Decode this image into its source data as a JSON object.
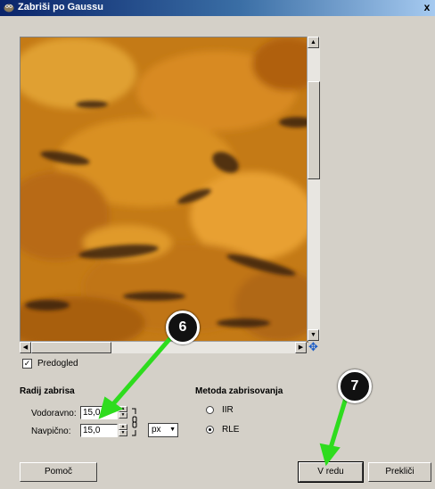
{
  "window": {
    "title": "Zabriši po Gaussu",
    "close_glyph": "x"
  },
  "preview": {
    "checkbox_label": "Predogled",
    "checked": true
  },
  "radius": {
    "section_title": "Radij zabrisa",
    "horizontal_label": "Vodoravno:",
    "horizontal_value": "15,0",
    "vertical_label": "Navpično:",
    "vertical_value": "15,0",
    "unit": "px"
  },
  "method": {
    "section_title": "Metoda zabrisovanja",
    "options": [
      {
        "label": "IIR",
        "selected": false
      },
      {
        "label": "RLE",
        "selected": true
      }
    ]
  },
  "buttons": {
    "help": "Pomoč",
    "ok": "V redu",
    "cancel": "Prekliči"
  },
  "callouts": [
    "6",
    "7"
  ],
  "colors": {
    "annotation_arrow": "#2edc1e",
    "title_bar": "#0a246a"
  },
  "icons": [
    "gimp-icon",
    "close-icon",
    "navigate-icon",
    "chain-link-icon"
  ]
}
